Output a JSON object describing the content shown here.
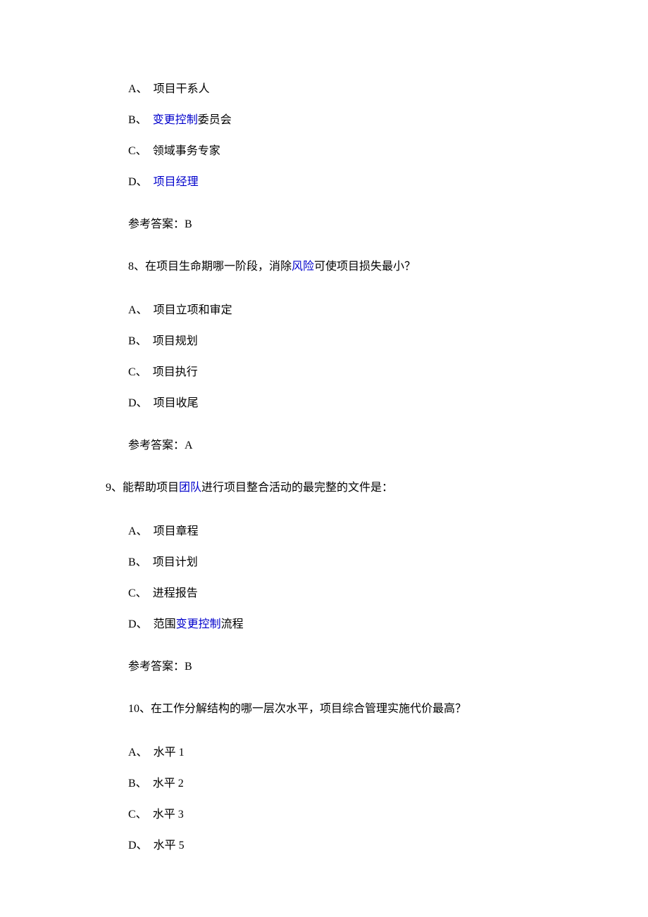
{
  "q7": {
    "options": {
      "A": {
        "label": "A、",
        "text": "项目干系人"
      },
      "B": {
        "label": "B、",
        "link": "变更控制",
        "suffix": "委员会"
      },
      "C": {
        "label": "C、",
        "text": "领域事务专家"
      },
      "D": {
        "label": "D、",
        "link": "项目经理"
      }
    },
    "answer": "参考答案：B"
  },
  "q8": {
    "prompt_pre": "8、在项目生命期哪一阶段，消除",
    "prompt_link": "风险",
    "prompt_post": "可使项目损失最小？",
    "options": {
      "A": {
        "label": "A、",
        "text": "项目立项和审定"
      },
      "B": {
        "label": "B、",
        "text": "项目规划"
      },
      "C": {
        "label": "C、",
        "text": "项目执行"
      },
      "D": {
        "label": "D、",
        "text": "项目收尾"
      }
    },
    "answer": "参考答案：A"
  },
  "q9": {
    "prompt_pre": "9、能帮助项目",
    "prompt_link": "团队",
    "prompt_post": "进行项目整合活动的最完整的文件是：",
    "options": {
      "A": {
        "label": "A、",
        "text": "项目章程"
      },
      "B": {
        "label": "B、",
        "text": "项目计划"
      },
      "C": {
        "label": "C、",
        "text": "进程报告"
      },
      "D": {
        "label": "D、",
        "pre": "范围",
        "link": "变更控制",
        "post": "流程"
      }
    },
    "answer": "参考答案：B"
  },
  "q10": {
    "prompt": "10、在工作分解结构的哪一层次水平，项目综合管理实施代价最高？",
    "options": {
      "A": {
        "label": "A、",
        "text": "水平 1"
      },
      "B": {
        "label": "B、",
        "text": "水平 2"
      },
      "C": {
        "label": "C、",
        "text": "水平 3"
      },
      "D": {
        "label": "D、",
        "text": "水平 5"
      }
    }
  }
}
